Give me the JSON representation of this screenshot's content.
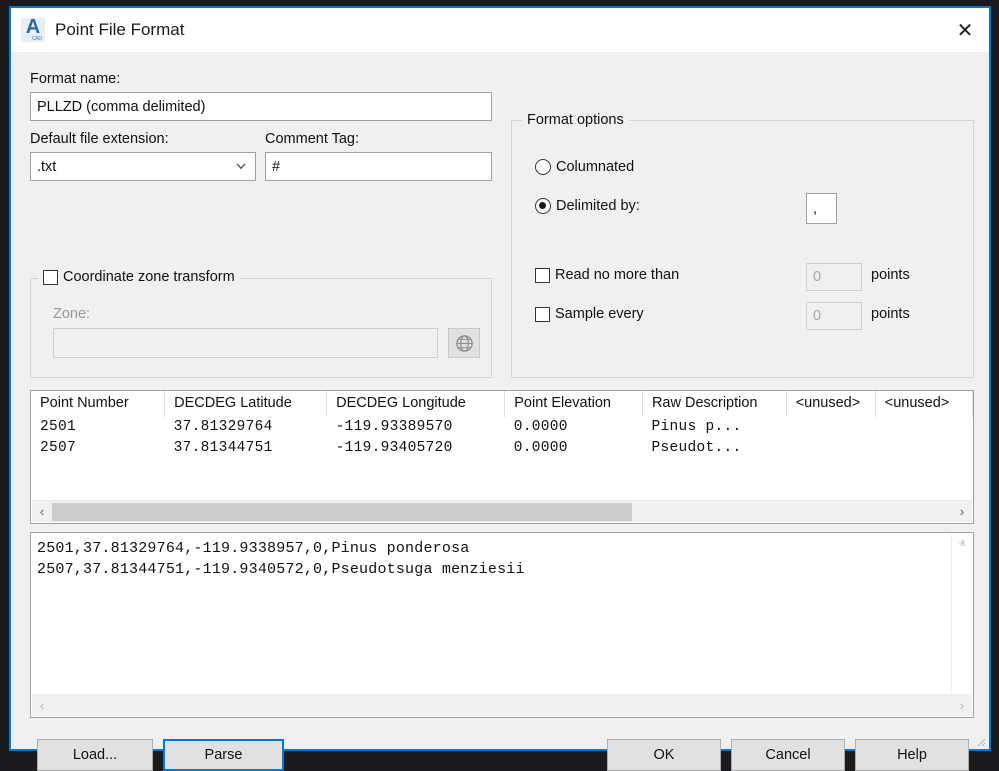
{
  "window": {
    "title": "Point File Format",
    "app_icon": "autocad-a-icon",
    "close_label": "✕",
    "accent_color": "#0078d7"
  },
  "form": {
    "format_name_label": "Format name:",
    "format_name_value": "PLLZD (comma delimited)",
    "default_ext_label": "Default file extension:",
    "default_ext_value": ".txt",
    "comment_tag_label": "Comment Tag:",
    "comment_tag_value": "#"
  },
  "coordinate_zone": {
    "group_label": "Coordinate zone transform",
    "checked": false,
    "zone_label": "Zone:",
    "zone_value": "",
    "globe_button": "globe-icon"
  },
  "format_options": {
    "group_label": "Format options",
    "columnated_label": "Columnated",
    "columnated_selected": false,
    "delimited_label": "Delimited by:",
    "delimited_selected": true,
    "delimiter_value": ",",
    "read_no_more_than_label": "Read no more than",
    "read_no_more_than_checked": false,
    "read_no_more_than_value": "0",
    "read_points_label": "points",
    "sample_every_label": "Sample every",
    "sample_every_checked": false,
    "sample_every_value": "0",
    "sample_points_label": "points"
  },
  "table": {
    "columns": [
      "Point Number",
      "DECDEG Latitude",
      "DECDEG Longitude",
      "Point Elevation",
      "Raw Description",
      "<unused>",
      "<unused>"
    ],
    "rows": [
      [
        "2501",
        "37.81329764",
        "-119.93389570",
        "0.0000",
        "Pinus p...",
        "",
        ""
      ],
      [
        "2507",
        "37.81344751",
        "-119.93405720",
        "0.0000",
        "Pseudot...",
        "",
        ""
      ]
    ],
    "scroll_left_arrow": "‹",
    "scroll_right_arrow": "›"
  },
  "preview": {
    "lines": "2501,37.81329764,-119.9338957,0,Pinus ponderosa\n2507,37.81344751,-119.9340572,0,Pseudotsuga menziesii",
    "scroll_up_arrow": "ⱏ",
    "scroll_down_arrow": "ⱟ",
    "scroll_left_arrow": "‹",
    "scroll_right_arrow": "›"
  },
  "buttons": {
    "load": "Load...",
    "parse": "Parse",
    "ok": "OK",
    "cancel": "Cancel",
    "help": "Help"
  }
}
